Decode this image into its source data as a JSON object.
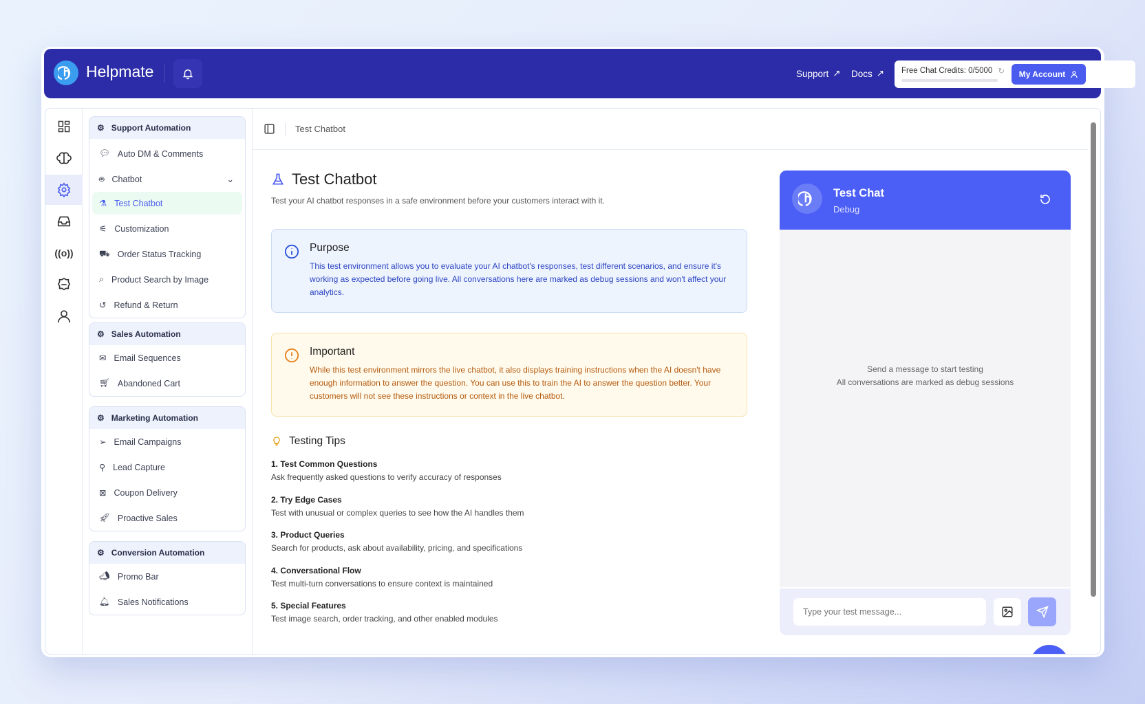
{
  "header": {
    "brand": "Helpmate",
    "support": "Support",
    "docs": "Docs",
    "credits": "Free Chat Credits: 0/5000",
    "credits_used_fraction": 0,
    "account": "My Account"
  },
  "sidebar": {
    "groups": [
      {
        "title": "Support Automation",
        "items": [
          {
            "label": "Auto DM & Comments",
            "icon": "chat-icon"
          },
          {
            "label": "Chatbot",
            "icon": "bot-icon"
          },
          {
            "label": "Test Chatbot",
            "icon": "flask-icon",
            "selected": true
          },
          {
            "label": "Customization",
            "icon": "sliders-icon"
          },
          {
            "label": "Order Status Tracking",
            "icon": "truck-icon"
          },
          {
            "label": "Product Search by Image",
            "icon": "scan-icon"
          },
          {
            "label": "Refund & Return",
            "icon": "refund-icon"
          }
        ]
      },
      {
        "title": "Sales Automation",
        "items": [
          {
            "label": "Email Sequences",
            "icon": "mail-icon"
          },
          {
            "label": "Abandoned Cart",
            "icon": "cart-icon"
          }
        ]
      },
      {
        "title": "Marketing Automation",
        "items": [
          {
            "label": "Email Campaigns",
            "icon": "send-icon"
          },
          {
            "label": "Lead Capture",
            "icon": "user-search-icon"
          },
          {
            "label": "Coupon Delivery",
            "icon": "ticket-icon"
          },
          {
            "label": "Proactive Sales",
            "icon": "rocket-icon"
          }
        ]
      },
      {
        "title": "Conversion Automation",
        "items": [
          {
            "label": "Promo Bar",
            "icon": "megaphone-icon"
          },
          {
            "label": "Sales Notifications",
            "icon": "bell-icon"
          }
        ]
      }
    ]
  },
  "breadcrumb": "Test Chatbot",
  "page": {
    "title": "Test Chatbot",
    "subtitle": "Test your AI chatbot responses in a safe environment before your customers interact with it.",
    "purpose": {
      "title": "Purpose",
      "text": "This test environment allows you to evaluate your AI chatbot's responses, test different scenarios, and ensure it's working as expected before going live. All conversations here are marked as debug sessions and won't affect your analytics."
    },
    "important": {
      "title": "Important",
      "text": "While this test environment mirrors the live chatbot, it also displays training instructions when the AI doesn't have enough information to answer the question. You can use this to train the AI to answer the question better. Your customers will not see these instructions or context in the live chatbot."
    },
    "tips_title": "Testing Tips",
    "tips": [
      {
        "title": "1. Test Common Questions",
        "text": "Ask frequently asked questions to verify accuracy of responses"
      },
      {
        "title": "2. Try Edge Cases",
        "text": "Test with unusual or complex queries to see how the AI handles them"
      },
      {
        "title": "3. Product Queries",
        "text": "Search for products, ask about availability, pricing, and specifications"
      },
      {
        "title": "4. Conversational Flow",
        "text": "Test multi-turn conversations to ensure context is maintained"
      },
      {
        "title": "5. Special Features",
        "text": "Test image search, order tracking, and other enabled modules"
      }
    ]
  },
  "chat": {
    "title": "Test Chat",
    "subtitle": "Debug",
    "empty_line1": "Send a message to start testing",
    "empty_line2": "All conversations are marked as debug sessions",
    "placeholder": "Type your test message..."
  },
  "colors": {
    "header": "#2c2ca8",
    "accent": "#4b5ef5"
  }
}
